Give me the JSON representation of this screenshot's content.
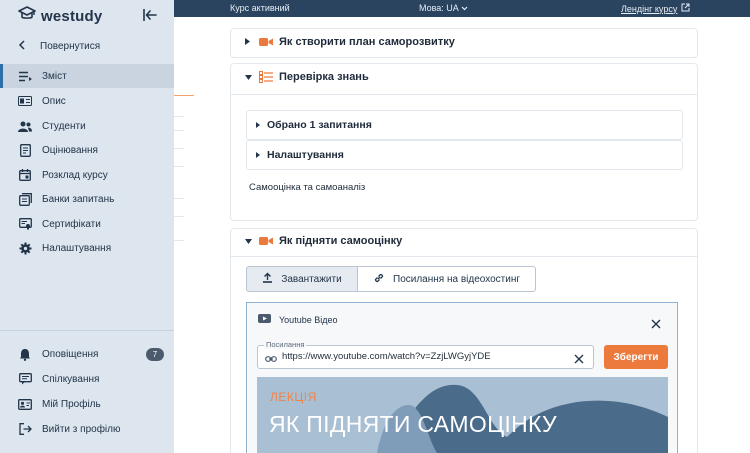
{
  "brand": {
    "name": "westudy"
  },
  "sidebar": {
    "back_label": "Повернутися",
    "items": [
      {
        "label": "Зміст",
        "icon": "list-icon",
        "active": true
      },
      {
        "label": "Опис",
        "icon": "id-card-icon"
      },
      {
        "label": "Студенти",
        "icon": "users-icon"
      },
      {
        "label": "Оцінювання",
        "icon": "clipboard-icon"
      },
      {
        "label": "Розклад курсу",
        "icon": "calendar-icon"
      },
      {
        "label": "Банки запитань",
        "icon": "question-bank-icon"
      },
      {
        "label": "Сертифікати",
        "icon": "certificate-icon"
      },
      {
        "label": "Налаштування",
        "icon": "gear-icon"
      }
    ],
    "bottom_items": [
      {
        "label": "Оповіщення",
        "icon": "bell-icon",
        "badge": "7"
      },
      {
        "label": "Спілкування",
        "icon": "chat-icon"
      },
      {
        "label": "Мій Профіль",
        "icon": "profile-icon"
      },
      {
        "label": "Вийти з профілю",
        "icon": "logout-icon"
      }
    ]
  },
  "topbar": {
    "status": "Курс активний",
    "language": "Мова: UA",
    "landing_link": "Лендінг курсу"
  },
  "sections": {
    "plan": {
      "title": "Як створити план саморозвитку",
      "icon": "video-icon"
    },
    "quiz": {
      "title": "Перевірка знань",
      "icon": "checklist-icon",
      "selected_questions": "Обрано 1 запитання",
      "settings": "Налаштування",
      "description": "Самооцінка та самоаналіз"
    },
    "selfesteem": {
      "title": "Як підняти самооцінку",
      "icon": "video-icon",
      "tabs": [
        "Завантажити",
        "Посилання на відеохостинг"
      ],
      "video_panel": {
        "title": "Youtube Відео",
        "field_label": "Посилання",
        "url": "https://www.youtube.com/watch?v=ZzjLWGyjYDE",
        "save_label": "Зберегти"
      },
      "thumbnail": {
        "label": "ЛЕКЦІЯ",
        "title": "ЯК ПІДНЯТИ САМОЦІНКУ"
      }
    }
  },
  "colors": {
    "sidebar_bg": "#dde5ee",
    "topbar_bg": "#2a4460",
    "accent_orange": "#ec7a3c",
    "active_indicator": "#2f6fa8",
    "thumbnail_dark": "#4a6b8a",
    "thumbnail_light": "#a9bfd3"
  }
}
